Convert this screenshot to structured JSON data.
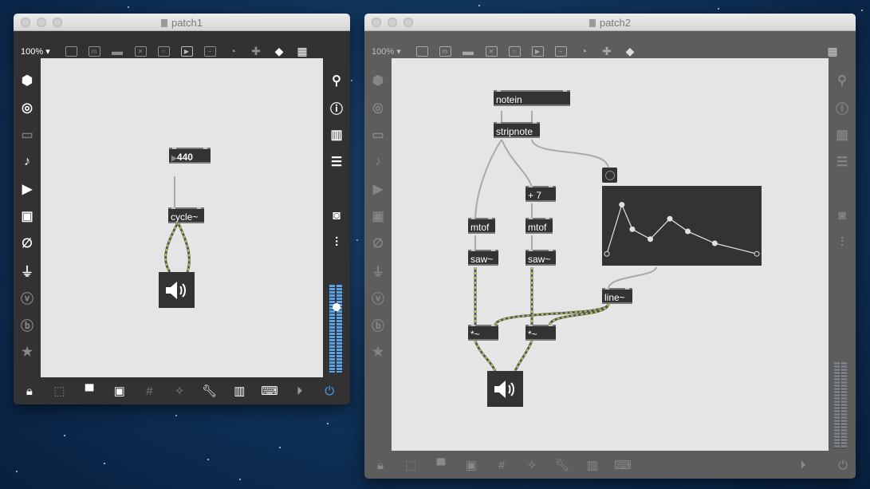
{
  "window1": {
    "title": "patch1",
    "zoom": "100% ▾",
    "objects": {
      "number": "440",
      "cycle": "cycle~"
    }
  },
  "window2": {
    "title": "patch2",
    "zoom": "100% ▾",
    "objects": {
      "notein": "notein",
      "stripnote": "stripnote",
      "plus7": "+ 7",
      "mtof_a": "mtof",
      "mtof_b": "mtof",
      "saw_a": "saw~",
      "saw_b": "saw~",
      "line": "line~",
      "mul_a": "*~",
      "mul_b": "*~"
    },
    "function_points": [
      [
        0,
        0.1
      ],
      [
        0.1,
        0.8
      ],
      [
        0.17,
        0.45
      ],
      [
        0.29,
        0.31
      ],
      [
        0.42,
        0.6
      ],
      [
        0.54,
        0.42
      ],
      [
        0.72,
        0.25
      ],
      [
        1,
        0.1
      ]
    ]
  },
  "colors": {
    "window1_bg": "#323232",
    "window2_bg": "#5d5d5d",
    "object_fill": "#333333",
    "patch_cord": "#a9a9a9",
    "signal_cord": "#b0c74a",
    "dsp_blue": "#4aa3ff"
  },
  "icons": {
    "toolbar": [
      "presentation-icon",
      "comment-icon",
      "message-icon",
      "toggle-icon",
      "bang-icon",
      "play-icon",
      "slider-icon",
      "dial-icon",
      "add-icon",
      "fill-icon",
      "grid-palette-icon"
    ],
    "sidebar_left": [
      "cube-icon",
      "target-icon",
      "tray-icon",
      "note-icon",
      "media-icon",
      "image-icon",
      "clip-icon",
      "plug-icon",
      "v-icon",
      "b-icon",
      "star-icon"
    ],
    "sidebar_right": [
      "search-icon",
      "info-icon",
      "book-icon",
      "list-icon",
      "camera-icon",
      "mixer-icon"
    ],
    "bottom": [
      "lock-icon",
      "select-icon",
      "presentation-icon",
      "window-icon",
      "grid-icon",
      "wand-icon",
      "wrench-icon",
      "piano-icon",
      "keyboard-icon",
      "play-icon",
      "power-icon"
    ]
  }
}
